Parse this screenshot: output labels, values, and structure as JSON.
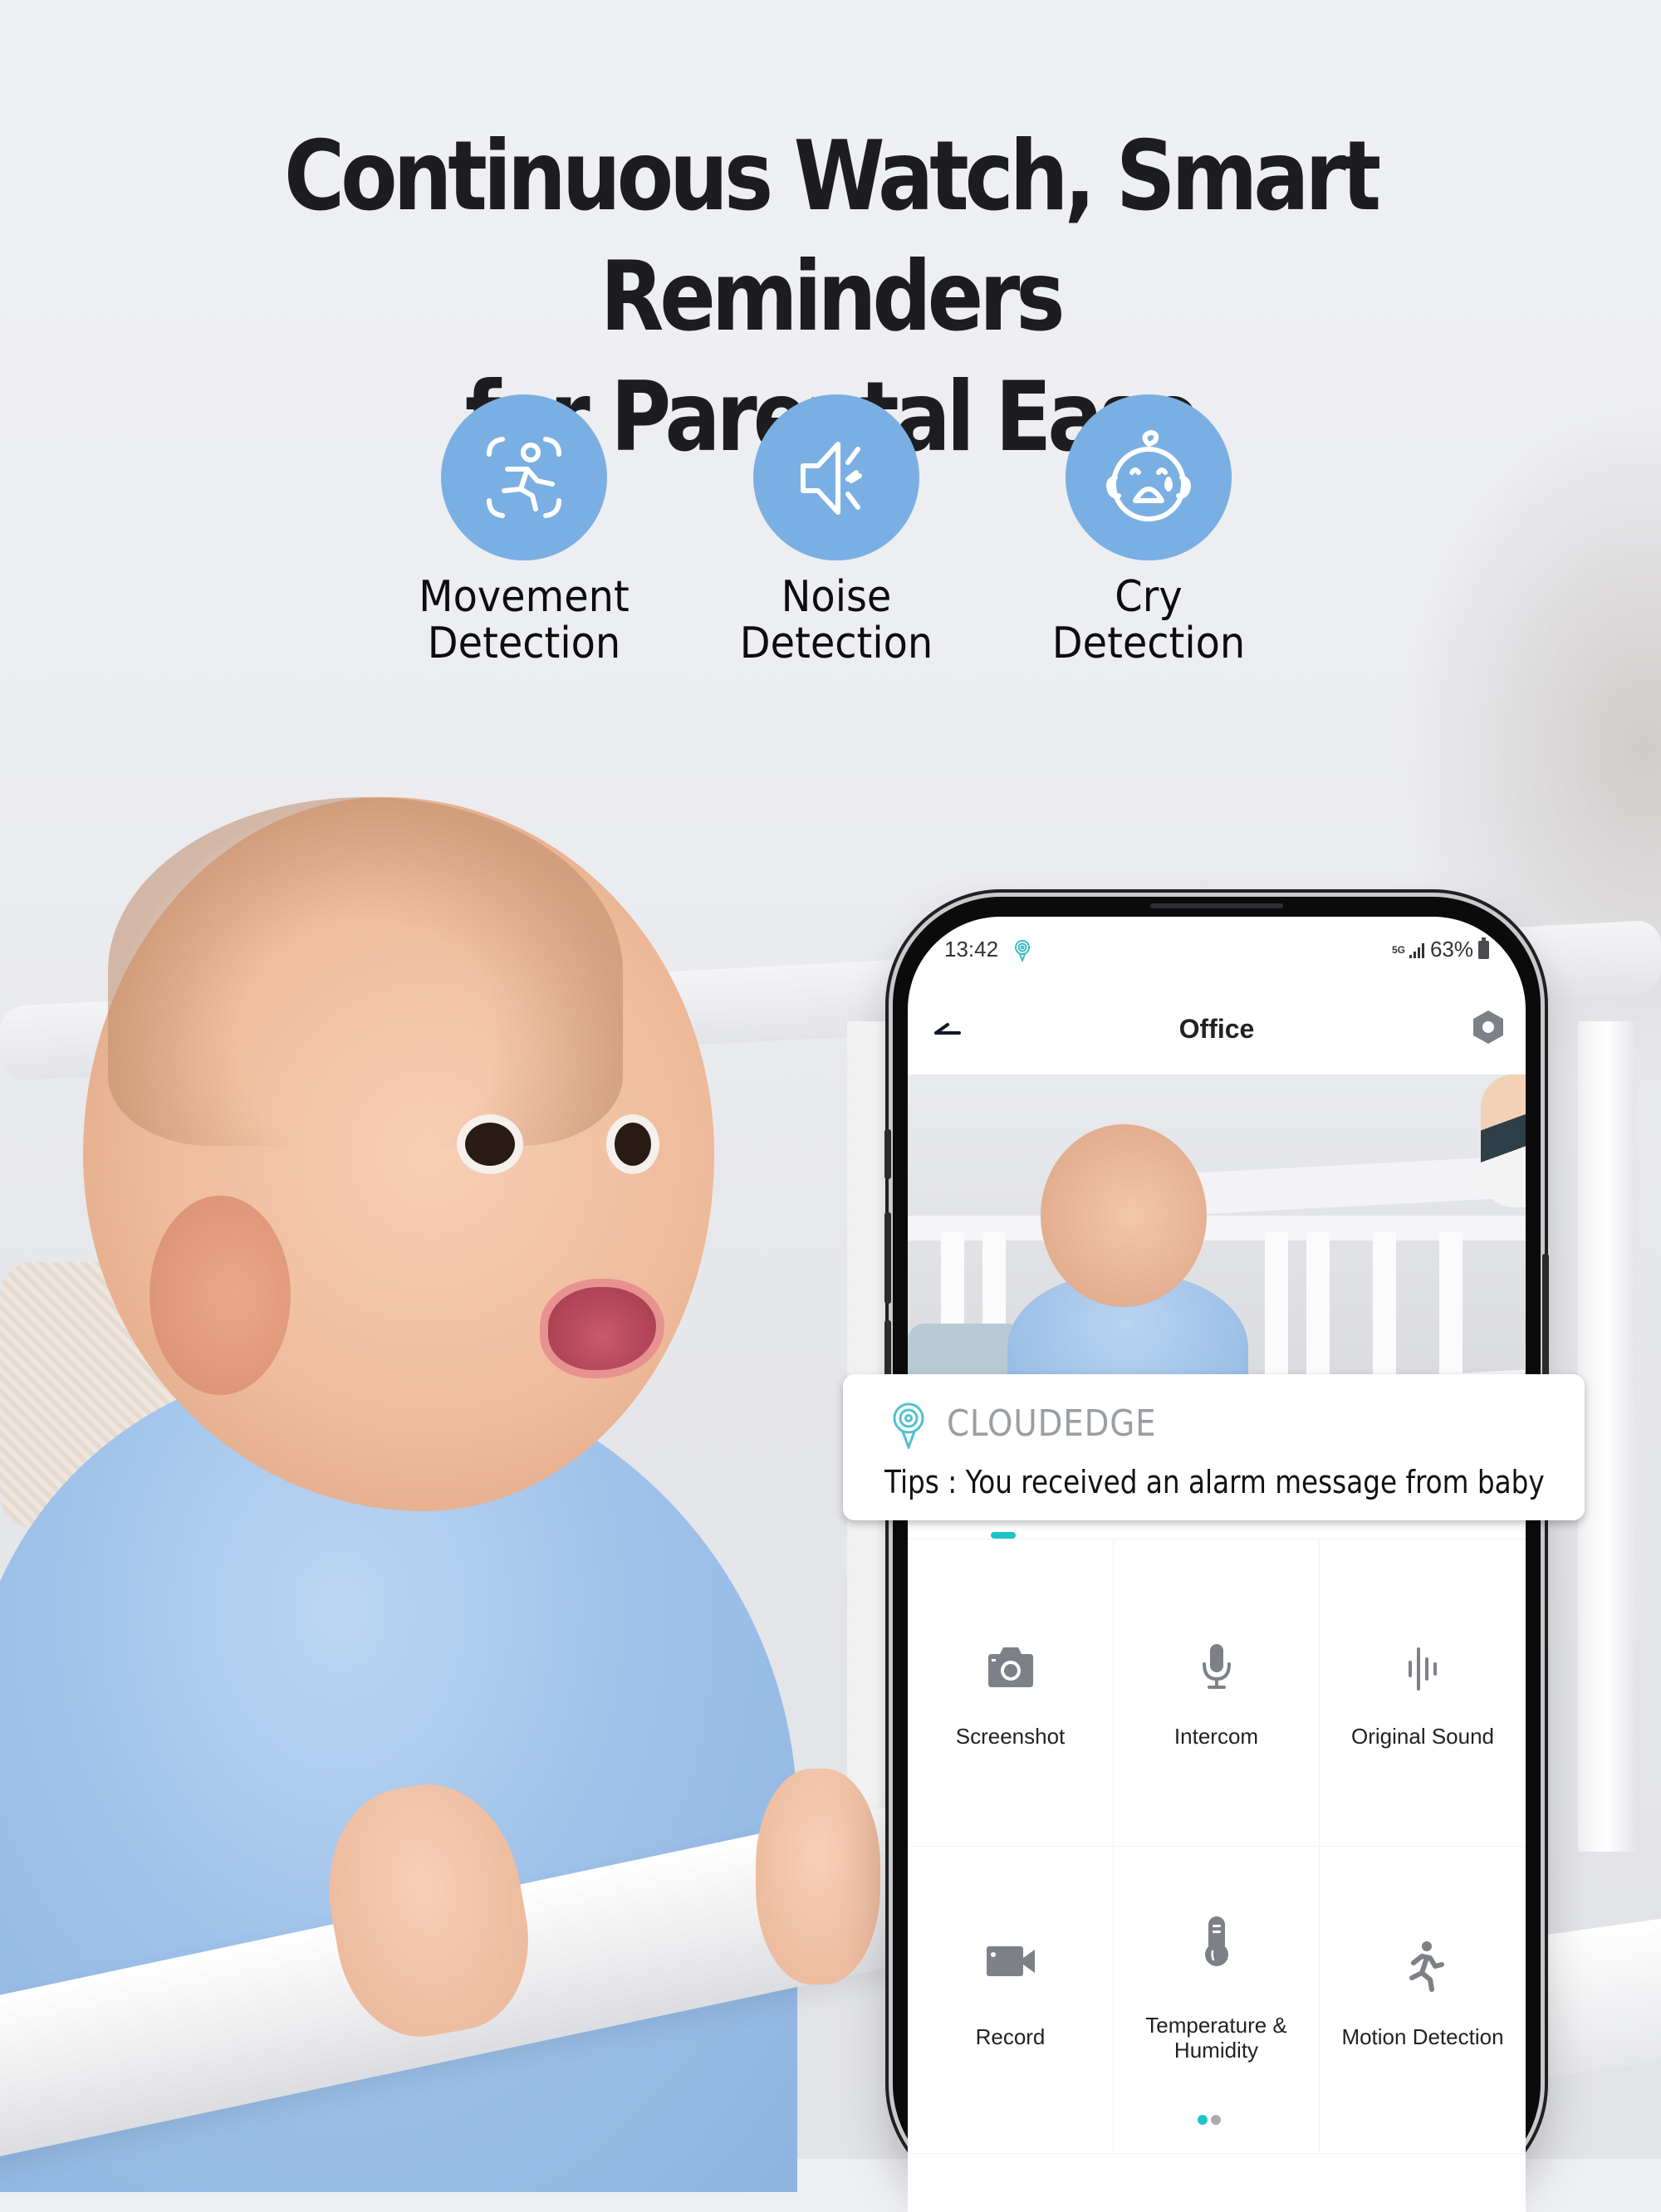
{
  "headline": {
    "line1": "Continuous Watch, Smart Reminders",
    "line2": "for Parental Ease"
  },
  "features": [
    {
      "icon": "running-person-in-frame-icon",
      "line1": "Movement",
      "line2": "Detection"
    },
    {
      "icon": "speaker-sound-icon",
      "line1": "Noise",
      "line2": "Detection"
    },
    {
      "icon": "crying-baby-face-icon",
      "line1": "Cry",
      "line2": "Detection"
    }
  ],
  "colors": {
    "feature_circle": "#7AAFE3",
    "accent": "#1EC3C6",
    "icon_gray": "#7D8187",
    "brand_gray": "#9A9EA3"
  },
  "phone": {
    "status_bar": {
      "time": "13:42",
      "network": "5G",
      "battery": "63%"
    },
    "header": {
      "title": "Office",
      "back_icon": "back-arrow-icon",
      "settings_icon": "hex-settings-icon"
    },
    "controls": [
      {
        "icon": "camera-icon",
        "label": "Screenshot"
      },
      {
        "icon": "microphone-icon",
        "label": "Intercom"
      },
      {
        "icon": "sound-wave-icon",
        "label": "Original Sound"
      },
      {
        "icon": "video-camera-icon",
        "label": "Record"
      },
      {
        "icon": "thermometer-icon",
        "label": "Temperature &",
        "label2": "Humidity"
      },
      {
        "icon": "running-person-icon",
        "label": "Motion Detection"
      }
    ],
    "pagination": {
      "current": 1,
      "total": 2
    }
  },
  "notification": {
    "brand": "CLOUDEDGE",
    "message": "Tips : You received an alarm message from baby"
  }
}
